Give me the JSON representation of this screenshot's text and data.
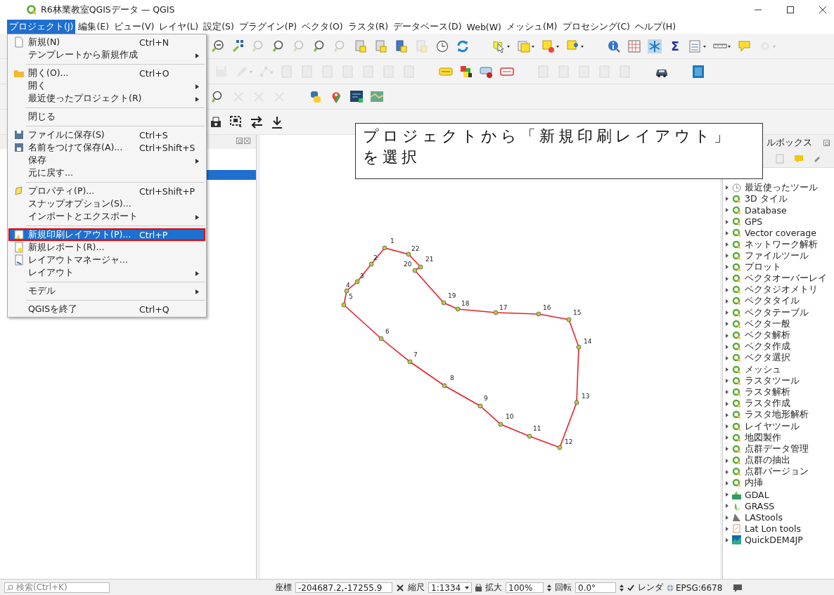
{
  "window": {
    "title": "R6林業教室QGISデータ — QGIS"
  },
  "menu_bar": [
    {
      "label": "プロジェクト(J)",
      "selected": true
    },
    {
      "label": "編集(E)",
      "selected": false
    },
    {
      "label": "ビュー(V)",
      "selected": false
    },
    {
      "label": "レイヤ(L)",
      "selected": false
    },
    {
      "label": "設定(S)",
      "selected": false
    },
    {
      "label": "プラグイン(P)",
      "selected": false
    },
    {
      "label": "ベクタ(O)",
      "selected": false
    },
    {
      "label": "ラスタ(R)",
      "selected": false
    },
    {
      "label": "データベース(D)",
      "selected": false
    },
    {
      "label": "Web(W)",
      "selected": false
    },
    {
      "label": "メッシュ(M)",
      "selected": false
    },
    {
      "label": "プロセシング(C)",
      "selected": false
    },
    {
      "label": "ヘルプ(H)",
      "selected": false
    }
  ],
  "toolbar": {
    "statistics_label": "Σ"
  },
  "project_menu": {
    "items": [
      {
        "kind": "item",
        "label": "新規(N)",
        "shortcut": "Ctrl+N",
        "submenu": false,
        "selected": false
      },
      {
        "kind": "item",
        "label": "テンプレートから新規作成",
        "submenu": true,
        "selected": false
      },
      {
        "kind": "separator"
      },
      {
        "kind": "item",
        "label": "開く(O)...",
        "shortcut": "Ctrl+O",
        "submenu": false,
        "selected": false
      },
      {
        "kind": "item",
        "label": "開く",
        "submenu": true,
        "selected": false
      },
      {
        "kind": "item",
        "label": "最近使ったプロジェクト(R)",
        "submenu": true,
        "selected": false
      },
      {
        "kind": "separator"
      },
      {
        "kind": "item",
        "label": "閉じる",
        "submenu": false,
        "selected": false
      },
      {
        "kind": "separator"
      },
      {
        "kind": "item",
        "label": "ファイルに保存(S)",
        "shortcut": "Ctrl+S",
        "submenu": false,
        "selected": false
      },
      {
        "kind": "item",
        "label": "名前をつけて保存(A)...",
        "shortcut": "Ctrl+Shift+S",
        "submenu": false,
        "selected": false
      },
      {
        "kind": "item",
        "label": "保存",
        "submenu": true,
        "selected": false
      },
      {
        "kind": "item",
        "label": "元に戻す...",
        "submenu": false,
        "selected": false
      },
      {
        "kind": "separator"
      },
      {
        "kind": "item",
        "label": "プロパティ(P)...",
        "shortcut": "Ctrl+Shift+P",
        "submenu": false,
        "selected": false
      },
      {
        "kind": "item",
        "label": "スナップオプション(S)...",
        "submenu": false,
        "selected": false
      },
      {
        "kind": "item",
        "label": "インポートとエクスポート",
        "submenu": true,
        "selected": false
      },
      {
        "kind": "separator"
      },
      {
        "kind": "item",
        "label": "新規印刷レイアウト(P)...",
        "shortcut": "Ctrl+P",
        "submenu": false,
        "selected": true,
        "annotated": true
      },
      {
        "kind": "item",
        "label": "新規レポート(R)...",
        "submenu": false,
        "selected": false
      },
      {
        "kind": "item",
        "label": "レイアウトマネージャ...",
        "submenu": false,
        "selected": false
      },
      {
        "kind": "item",
        "label": "レイアウト",
        "submenu": true,
        "selected": false
      },
      {
        "kind": "separator"
      },
      {
        "kind": "item",
        "label": "モデル",
        "submenu": true,
        "selected": false
      },
      {
        "kind": "separator"
      },
      {
        "kind": "item",
        "label": "QGISを終了",
        "shortcut": "Ctrl+Q",
        "submenu": false,
        "selected": false
      }
    ]
  },
  "layers_panel": {
    "rows": [
      {
        "selected": true
      }
    ]
  },
  "map": {
    "points": [
      {
        "label": "1"
      },
      {
        "label": "2"
      },
      {
        "label": "3"
      },
      {
        "label": "4"
      },
      {
        "label": "5"
      },
      {
        "label": "6"
      },
      {
        "label": "7"
      },
      {
        "label": "8"
      },
      {
        "label": "9"
      },
      {
        "label": "10"
      },
      {
        "label": "11"
      },
      {
        "label": "12"
      },
      {
        "label": "13"
      },
      {
        "label": "14"
      },
      {
        "label": "15"
      },
      {
        "label": "16"
      },
      {
        "label": "17"
      },
      {
        "label": "18"
      },
      {
        "label": "19"
      },
      {
        "label": "20"
      },
      {
        "label": "21"
      },
      {
        "label": "22"
      }
    ]
  },
  "callout": {
    "text": "プロジェクトから「新規印刷レイアウト」を選択"
  },
  "toolbox": {
    "title": "ルボックス",
    "items": [
      {
        "kind": "recent",
        "label": "最近使ったツール"
      },
      {
        "kind": "native",
        "label": "3D タイル"
      },
      {
        "kind": "native",
        "label": "Database"
      },
      {
        "kind": "native",
        "label": "GPS"
      },
      {
        "kind": "native",
        "label": "Vector coverage"
      },
      {
        "kind": "native",
        "label": "ネットワーク解析"
      },
      {
        "kind": "native",
        "label": "ファイルツール"
      },
      {
        "kind": "native",
        "label": "プロット"
      },
      {
        "kind": "native",
        "label": "ベクタオーバーレイ"
      },
      {
        "kind": "native",
        "label": "ベクタジオメトリ"
      },
      {
        "kind": "native",
        "label": "ベクタタイル"
      },
      {
        "kind": "native",
        "label": "ベクタテーブル"
      },
      {
        "kind": "native",
        "label": "ベクタ一般"
      },
      {
        "kind": "native",
        "label": "ベクタ解析"
      },
      {
        "kind": "native",
        "label": "ベクタ作成"
      },
      {
        "kind": "native",
        "label": "ベクタ選択"
      },
      {
        "kind": "native",
        "label": "メッシュ"
      },
      {
        "kind": "native",
        "label": "ラスタツール"
      },
      {
        "kind": "native",
        "label": "ラスタ解析"
      },
      {
        "kind": "native",
        "label": "ラスタ作成"
      },
      {
        "kind": "native",
        "label": "ラスタ地形解析"
      },
      {
        "kind": "native",
        "label": "レイヤツール"
      },
      {
        "kind": "native",
        "label": "地図製作"
      },
      {
        "kind": "native",
        "label": "点群データ管理"
      },
      {
        "kind": "native",
        "label": "点群の抽出"
      },
      {
        "kind": "native",
        "label": "点群バージョン"
      },
      {
        "kind": "native",
        "label": "内挿"
      },
      {
        "kind": "gdal",
        "label": "GDAL"
      },
      {
        "kind": "grass",
        "label": "GRASS"
      },
      {
        "kind": "lastools",
        "label": "LAStools"
      },
      {
        "kind": "latlon",
        "label": "Lat Lon tools"
      },
      {
        "kind": "quickdem",
        "label": "QuickDEM4JP"
      }
    ]
  },
  "status_bar": {
    "search_placeholder": "検索(Ctrl+K)",
    "coordinate_label": "座標",
    "coordinate": "-204687.2,-17255.9",
    "scale_label": "縮尺",
    "scale": "1:1334",
    "magnifier_label": "拡大",
    "magnifier": "100%",
    "rotation_label": "回転",
    "rotation": "0.0°",
    "render_checked": true,
    "render_label": "レンダ",
    "crs": "EPSG:6678"
  }
}
